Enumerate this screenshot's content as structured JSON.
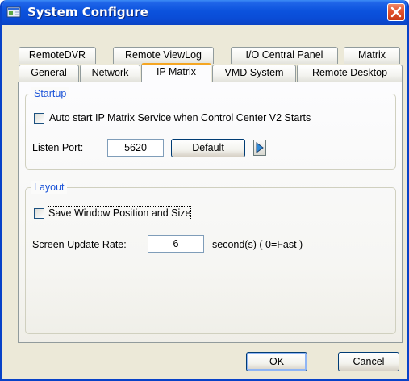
{
  "window": {
    "title": "System Configure"
  },
  "tabs_row1": [
    "RemoteDVR",
    "Remote ViewLog",
    "I/O Central Panel",
    "Matrix"
  ],
  "tabs_row2": [
    "General",
    "Network",
    "IP Matrix",
    "VMD System",
    "Remote Desktop"
  ],
  "active_tab": "IP Matrix",
  "startup": {
    "group_label": "Startup",
    "auto_start_label": "Auto start IP Matrix Service when Control Center V2 Starts",
    "auto_start_checked": false,
    "listen_port_label": "Listen Port:",
    "listen_port_value": "5620",
    "default_button": "Default"
  },
  "layout": {
    "group_label": "Layout",
    "save_window_label": "Save Window Position and Size",
    "save_window_checked": false,
    "update_rate_label": "Screen Update Rate:",
    "update_rate_value": "6",
    "update_rate_unit": "second(s) ( 0=Fast )"
  },
  "footer": {
    "ok_button": "OK",
    "cancel_button": "Cancel"
  },
  "colors": {
    "title_bar": "#0a4cd6",
    "active_tab_accent": "#f5a623",
    "group_label": "#1c54d8",
    "close_button": "#e2532f",
    "frame": "#0842c8"
  },
  "icons": {
    "app": "app-window-icon",
    "close": "close-icon",
    "arrow": "play-arrow-icon"
  }
}
